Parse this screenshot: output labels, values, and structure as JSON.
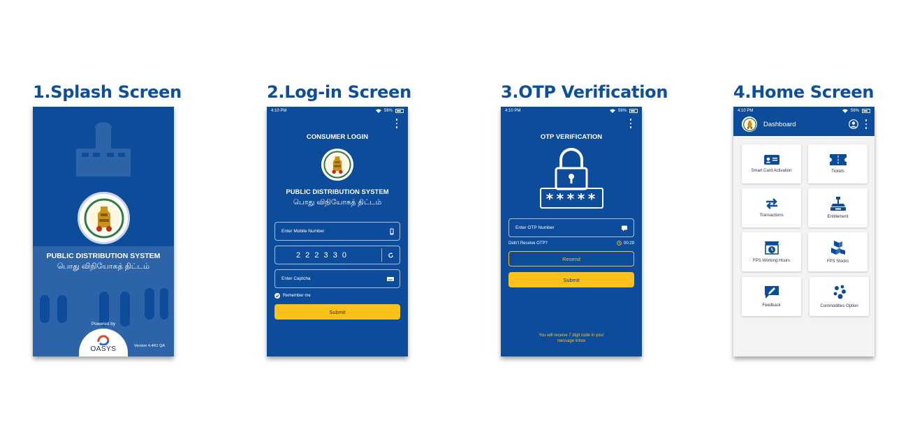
{
  "screens": [
    {
      "title": "1.Splash Screen"
    },
    {
      "title": "2.Log-in Screen"
    },
    {
      "title": "3.OTP Verification"
    },
    {
      "title": "4.Home Screen"
    }
  ],
  "colors": {
    "brand_blue": "#0d4c9a",
    "title_blue": "#0d4f9c",
    "accent_yellow": "#fcc21b",
    "home_bg": "#f3f3f3"
  },
  "status_bar": {
    "time": "4:10 PM",
    "battery": "56%"
  },
  "splash": {
    "system_name": "PUBLIC DISTRIBUTION SYSTEM",
    "system_name_tamil": "பொது விநியோகத் திட்டம்",
    "powered_by": "Powered by",
    "brand": "OASYS",
    "version": "Version 4.4R1 QA"
  },
  "login": {
    "heading": "CONSUMER LOGIN",
    "system_name": "PUBLIC DISTRIBUTION SYSTEM",
    "system_name_tamil": "பொது விநியோகத் திட்டம்",
    "mobile_placeholder": "Enter Mobile Number",
    "captcha_code": "2 2 2 3 3 0",
    "captcha_placeholder": "Enter Captcha",
    "remember_me": "Remember me",
    "submit": "Submit"
  },
  "otp": {
    "heading": "OTP VERIFICATION",
    "otp_mask": "*****",
    "otp_placeholder": "Enter OTP Number",
    "didnt_receive": "Didn't Receive OTP?",
    "timer": "00:29",
    "resend": "Resend",
    "submit": "Submit",
    "info_line1": "You will receive 7 digit code in your",
    "info_line2": "message inbox"
  },
  "home": {
    "header_title": "Dashboard",
    "tiles": [
      {
        "label": "Smart Card Activation",
        "icon": "id-card-icon"
      },
      {
        "label": "Tickets",
        "icon": "ticket-icon"
      },
      {
        "label": "Transactions",
        "icon": "transfer-arrows-icon"
      },
      {
        "label": "Entitlement",
        "icon": "weighing-scale-icon"
      },
      {
        "label": "FPS Working Hours",
        "icon": "shop-clock-icon"
      },
      {
        "label": "FPS Stocks",
        "icon": "stock-boxes-icon"
      },
      {
        "label": "Feedback",
        "icon": "feedback-chat-icon"
      },
      {
        "label": "Commodities Option",
        "icon": "commodities-icon"
      }
    ]
  }
}
